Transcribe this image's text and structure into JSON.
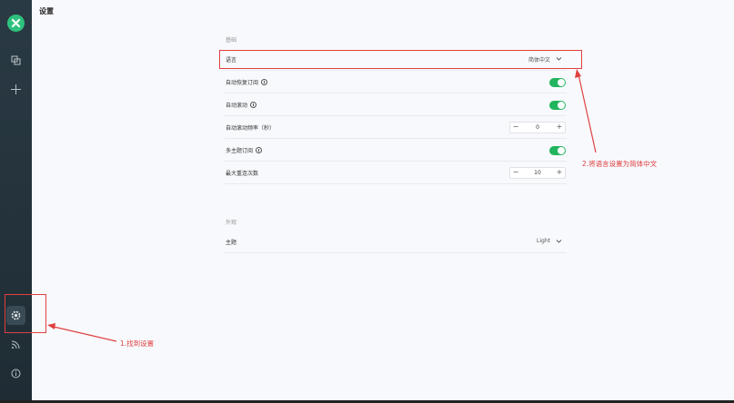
{
  "page": {
    "title": "设置"
  },
  "sidebar": {
    "items": [
      {
        "name": "logo-icon"
      },
      {
        "name": "copy-icon"
      },
      {
        "name": "plus-icon"
      },
      {
        "name": "settings-icon"
      },
      {
        "name": "rss-icon"
      },
      {
        "name": "info-icon"
      }
    ]
  },
  "basic": {
    "title": "基础",
    "language": {
      "label": "语言",
      "value": "简体中文"
    },
    "auto_restore": {
      "label": "自动恢复订阅",
      "enabled": true
    },
    "auto_scroll": {
      "label": "自动滚动",
      "enabled": true
    },
    "scroll_freq": {
      "label": "自动滚动频率（秒）",
      "value": "0"
    },
    "multi_topic": {
      "label": "多主题订阅",
      "enabled": true
    },
    "max_reconnect": {
      "label": "最大重连次数",
      "value": "10"
    }
  },
  "appearance": {
    "title": "外观",
    "theme": {
      "label": "主题",
      "value": "Light"
    }
  },
  "annotations": {
    "step1": "1.找到设置",
    "step2": "2.将语言设置为简体中文",
    "color": "#e04040"
  },
  "colors": {
    "toggle_on": "#22b45e",
    "sidebar": "#253540",
    "accent": "#2ec27e"
  }
}
